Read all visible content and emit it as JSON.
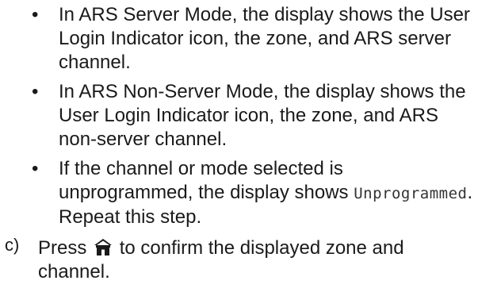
{
  "bullets": [
    {
      "text": "In ARS Server Mode, the display shows the User Login Indicator icon, the zone, and ARS server channel."
    },
    {
      "text": "In ARS Non-Server Mode, the display shows the User Login Indicator icon, the zone, and ARS non-server channel."
    },
    {
      "text_before": "If the channel or mode selected is unprogrammed, the display shows ",
      "display_text": "Unprogrammed",
      "text_after": ". Repeat this step."
    }
  ],
  "bullet_symbol": "•",
  "step": {
    "marker": "c)",
    "text_before": "Press",
    "icon": "home-icon",
    "text_after": "to confirm the displayed zone and channel."
  }
}
